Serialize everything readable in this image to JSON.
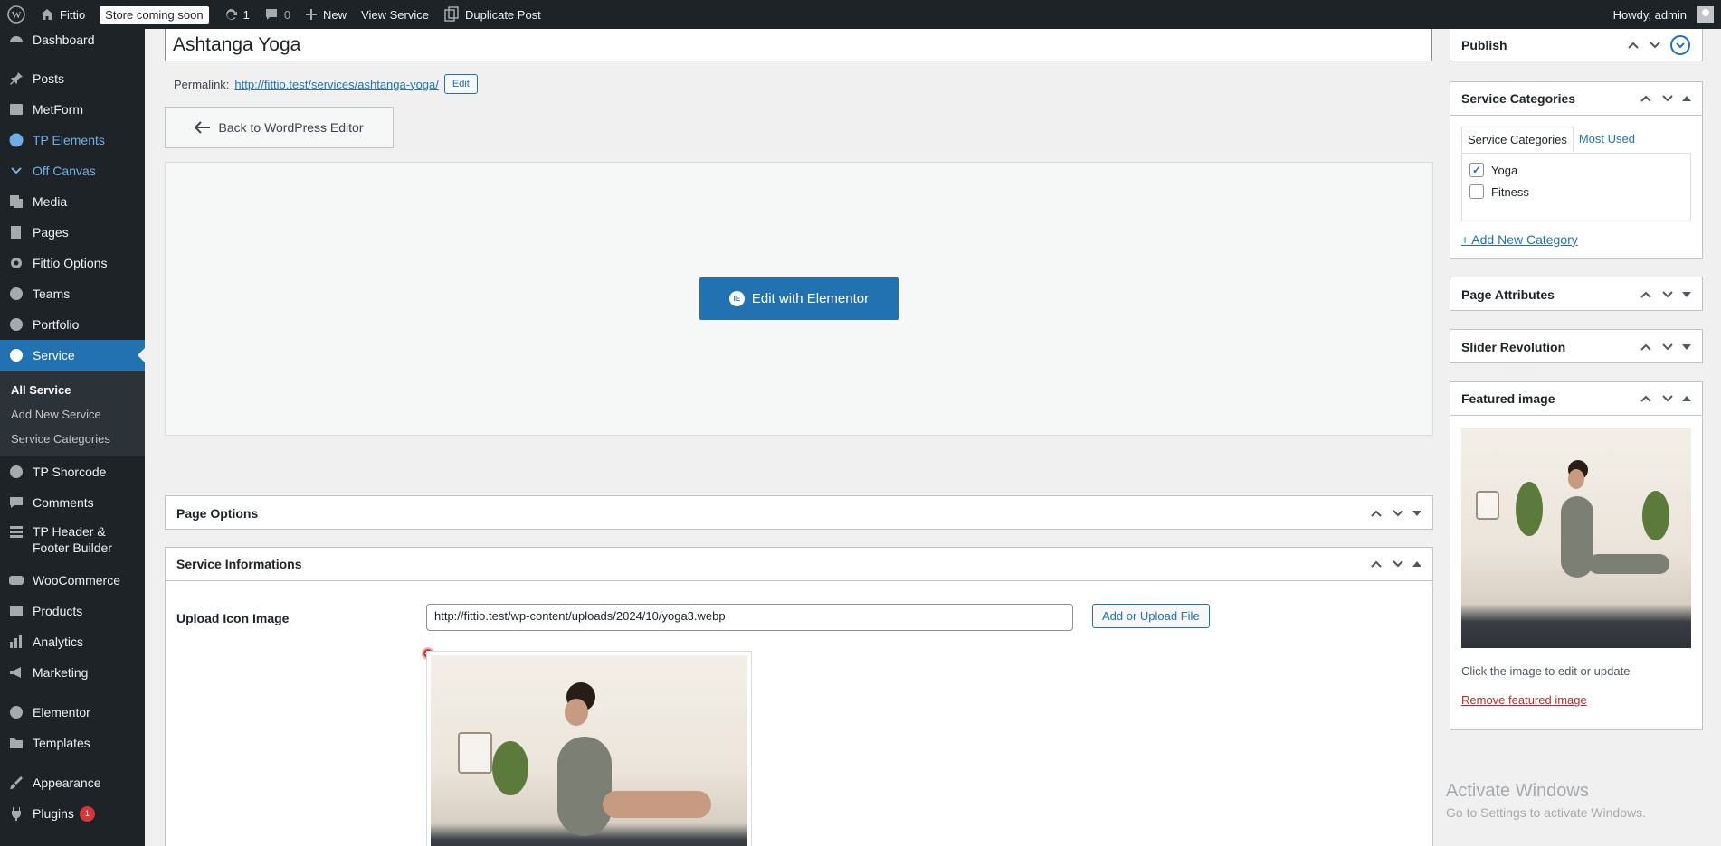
{
  "admin_bar": {
    "site_name": "Fittio",
    "store_badge": "Store coming soon",
    "updates_count": "1",
    "comments_count": "0",
    "new_label": "New",
    "view_label": "View Service",
    "duplicate_label": "Duplicate Post",
    "howdy": "Howdy, admin"
  },
  "sidebar": {
    "items": [
      {
        "label": "Dashboard",
        "icon": "dashboard-icon"
      },
      {
        "label": "Posts",
        "icon": "pin-icon"
      },
      {
        "label": "MetForm",
        "icon": "form-icon"
      },
      {
        "label": "TP Elements",
        "icon": "tp-icon"
      },
      {
        "label": "Off Canvas",
        "icon": "chevron-icon"
      },
      {
        "label": "Media",
        "icon": "media-icon"
      },
      {
        "label": "Pages",
        "icon": "pages-icon"
      },
      {
        "label": "Fittio Options",
        "icon": "gear-icon"
      },
      {
        "label": "Teams",
        "icon": "team-icon"
      },
      {
        "label": "Portfolio",
        "icon": "portfolio-icon"
      },
      {
        "label": "Service",
        "icon": "service-icon"
      },
      {
        "label": "TP Shorcode",
        "icon": "shortcode-icon"
      },
      {
        "label": "Comments",
        "icon": "comment-icon"
      },
      {
        "label": "TP Header & Footer Builder",
        "icon": "grid-icon"
      },
      {
        "label": "WooCommerce",
        "icon": "woo-icon"
      },
      {
        "label": "Products",
        "icon": "products-icon"
      },
      {
        "label": "Analytics",
        "icon": "analytics-icon"
      },
      {
        "label": "Marketing",
        "icon": "marketing-icon"
      },
      {
        "label": "Elementor",
        "icon": "elementor-icon"
      },
      {
        "label": "Templates",
        "icon": "templates-icon"
      },
      {
        "label": "Appearance",
        "icon": "brush-icon"
      },
      {
        "label": "Plugins",
        "icon": "plug-icon",
        "badge": "1"
      }
    ],
    "submenu": [
      "All Service",
      "Add New Service",
      "Service Categories"
    ]
  },
  "editor": {
    "title_value": "Ashtanga Yoga",
    "permalink_label": "Permalink:",
    "permalink_base": "http://fittio.test/services/",
    "permalink_slug": "ashtanga-yoga",
    "permalink_end": "/",
    "edit_label": "Edit",
    "back_label": "Back to WordPress Editor",
    "elementor_label": "Edit with Elementor"
  },
  "meta_boxes": {
    "page_options": "Page Options",
    "service_info": "Service Informations",
    "upload_label": "Upload Icon Image",
    "upload_value": "http://fittio.test/wp-content/uploads/2024/10/yoga3.webp",
    "upload_button": "Add or Upload File"
  },
  "right": {
    "publish": "Publish",
    "service_categories": "Service Categories",
    "tab_all": "Service Categories",
    "tab_most": "Most Used",
    "categories": [
      {
        "name": "Yoga",
        "checked": true
      },
      {
        "name": "Fitness",
        "checked": false
      }
    ],
    "add_new": "+ Add New Category",
    "page_attributes": "Page Attributes",
    "slider_revolution": "Slider Revolution",
    "featured_image": "Featured image",
    "click_hint": "Click the image to edit or update",
    "remove_featured": "Remove featured image"
  },
  "watermark": {
    "line1": "Activate Windows",
    "line2": "Go to Settings to activate Windows."
  }
}
